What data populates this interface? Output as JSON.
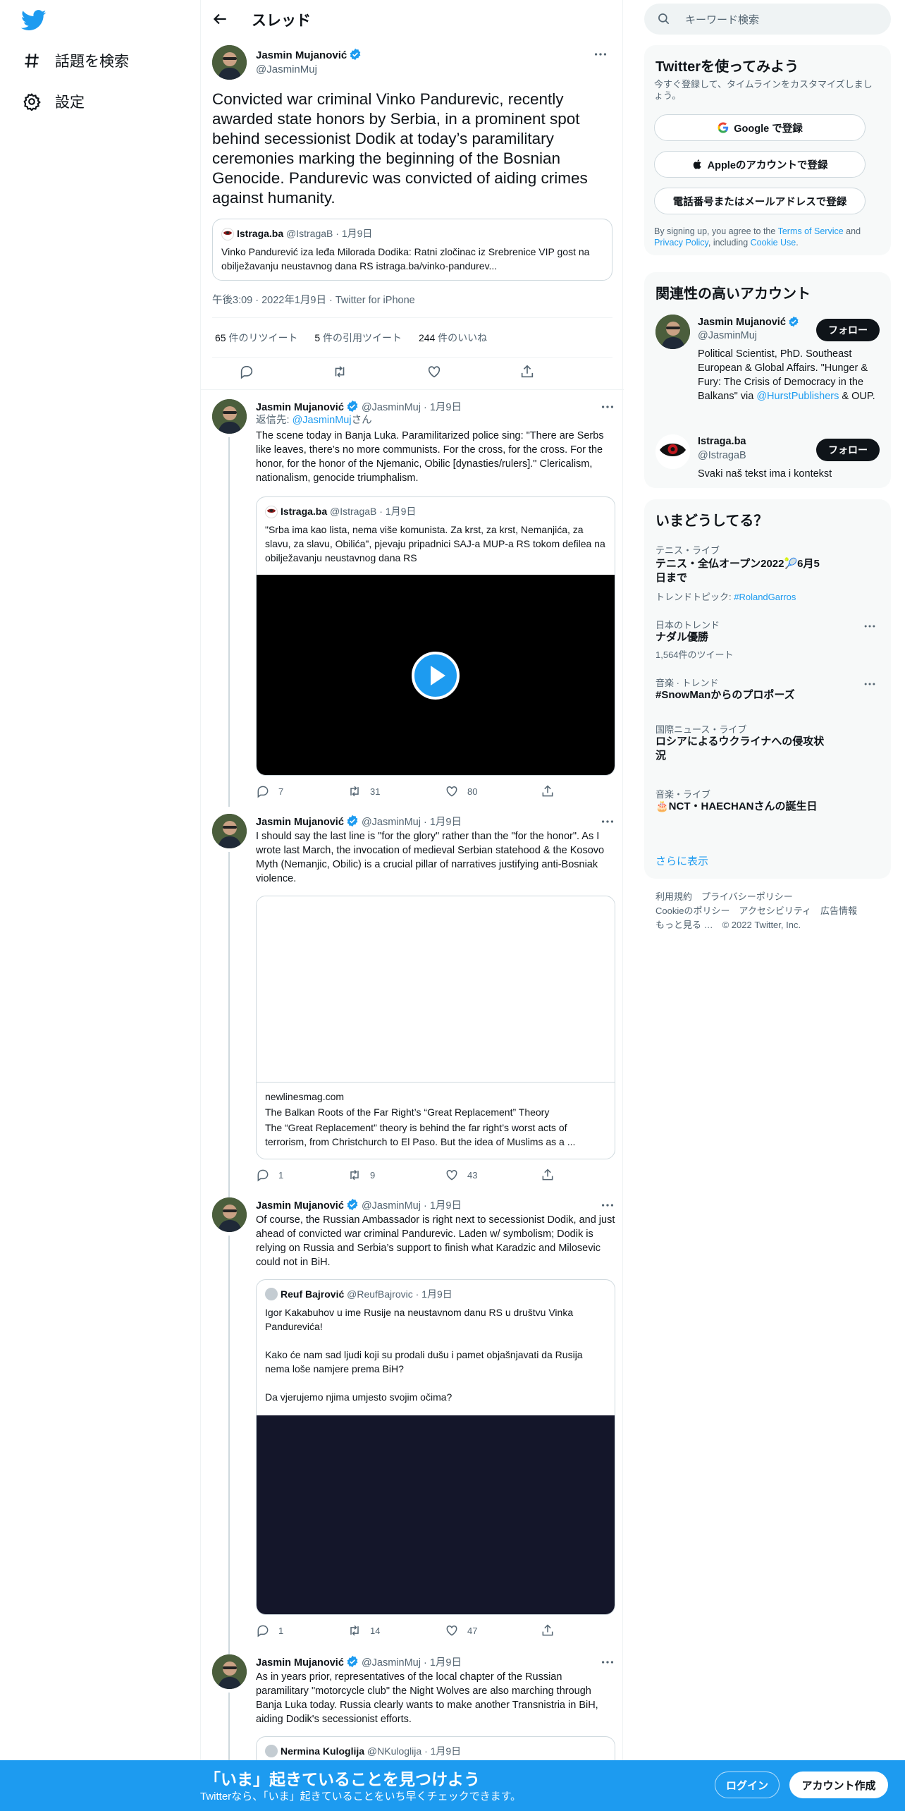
{
  "nav": {
    "explore": "話題を検索",
    "settings": "設定"
  },
  "header": {
    "title": "スレッド"
  },
  "main_tweet": {
    "name": "Jasmin Mujanović",
    "handle": "@JasminMuj",
    "text": "Convicted war criminal Vinko Pandurevic, recently awarded state honors by Serbia, in a prominent spot behind secessionist Dodik at today’s paramilitary ceremonies marking the beginning of the Bosnian Genocide. Pandurevic was convicted of aiding crimes against humanity.",
    "quote": {
      "name": "Istraga.ba",
      "handle": "@IstragaB",
      "date": "· 1月9日",
      "text": "Vinko Pandurević iza leđa Milorada Dodika: Ratni zločinac iz Srebrenice VIP gost na obilježavanju neustavnog dana RS istraga.ba/vinko-pandurev..."
    },
    "meta": "午後3:09 · 2022年1月9日 · Twitter for iPhone",
    "retweets": "65",
    "retweets_label": " 件のリツイート",
    "quotes": "5",
    "quotes_label": " 件の引用ツイート",
    "likes": "244",
    "likes_label": " 件のいいね"
  },
  "replies": [
    {
      "name": "Jasmin Mujanović",
      "handle": "@JasminMuj",
      "date": "· 1月9日",
      "replying_prefix": "返信先: ",
      "replying_handle": "@JasminMuj",
      "replying_suffix": "さん",
      "text": "The scene today in Banja Luka. Paramilitarized police sing: \"There are Serbs like leaves, there’s no more communists. For the cross, for the cross. For the honor, for the honor of the Njemanic, Obilic [dynasties/rulers].\" Clericalism, nationalism, genocide triumphalism.",
      "quote": {
        "name": "Istraga.ba",
        "handle": "@IstragaB",
        "date": "· 1月9日",
        "text": "\"Srba ima kao lista, nema više komunista. Za krst, za krst, Nemanjića, za slavu, za slavu, Obilića\", pjevaju pripadnici SAJ-a MUP-a RS tokom defilea na obilježavanju neustavnog dana RS"
      },
      "replies": "7",
      "retweets": "31",
      "likes": "80"
    },
    {
      "name": "Jasmin Mujanović",
      "handle": "@JasminMuj",
      "date": "· 1月9日",
      "text": "I should say the last line is \"for the glory\" rather than the \"for the honor\". As I wrote last March, the invocation of medieval Serbian statehood & the Kosovo Myth (Nemanjic, Obilic) is a crucial pillar of narratives justifying anti-Bosniak violence.",
      "card": {
        "domain": "newlinesmag.com",
        "title": "The Balkan Roots of the Far Right’s “Great Replacement” Theory",
        "desc": "The “Great Replacement” theory is behind the far right’s worst acts of terrorism, from Christchurch to El Paso. But the idea of Muslims as a ..."
      },
      "replies": "1",
      "retweets": "9",
      "likes": "43"
    },
    {
      "name": "Jasmin Mujanović",
      "handle": "@JasminMuj",
      "date": "· 1月9日",
      "text": "Of course, the Russian Ambassador is right next to secessionist Dodik, and just ahead of convicted war criminal Pandurevic. Laden w/ symbolism; Dodik is relying on Russia and Serbia’s support to finish what Karadzic and Milosevic could not in BiH.",
      "quote": {
        "name": "Reuf Bajrović",
        "handle": "@ReufBajrovic",
        "date": "· 1月9日",
        "text1": "Igor Kakabuhov u ime Rusije na neustavnom danu RS u društvu Vinka Pandurevića!",
        "text2": "Kako će nam sad ljudi koji su prodali dušu i pamet objašnjavati da Rusija nema loše namjere prema BiH?",
        "text3": "Da vjerujemo njima umjesto svojim očima?"
      },
      "replies": "1",
      "retweets": "14",
      "likes": "47"
    },
    {
      "name": "Jasmin Mujanović",
      "handle": "@JasminMuj",
      "date": "· 1月9日",
      "text": "As in years prior, representatives of the local chapter of the Russian paramilitary \"motorcycle club\" the Night Wolves are also marching through Banja Luka today. Russia clearly wants to make another Transnistria in BiH, aiding Dodik's secessionist efforts.",
      "quote": {
        "name": "Nermina Kuloglija",
        "handle": "@NKuloglija",
        "date": "· 1月9日"
      }
    }
  ],
  "right": {
    "search_placeholder": "キーワード検索",
    "signup": {
      "title": "Twitterを使ってみよう",
      "desc": "今すぐ登録して、タイムラインをカスタマイズしましょう。",
      "google": "Google で登録",
      "apple": "Appleのアカウントで登録",
      "phone": "電話番号またはメールアドレスで登録",
      "legal_1": "By signing up, you agree to the ",
      "legal_tos": "Terms of Service",
      "legal_2": " and ",
      "legal_privacy": "Privacy Policy",
      "legal_3": ", including ",
      "legal_cookie": "Cookie Use",
      "legal_4": "."
    },
    "relevant": {
      "title": "関連性の高いアカウント",
      "accounts": [
        {
          "name": "Jasmin Mujanović",
          "handle": "@JasminMuj",
          "bio_1": "Political Scientist, PhD. Southeast European & Global Affairs. \"Hunger & Fury: The Crisis of Democracy in the Balkans\" via ",
          "bio_link": "@HurstPublishers",
          "bio_2": " & OUP.",
          "follow": "フォロー"
        },
        {
          "name": "Istraga.ba",
          "handle": "@IstragaB",
          "bio_1": "Svaki naš tekst ima i kontekst",
          "follow": "フォロー"
        }
      ]
    },
    "trends": {
      "title": "いまどうしてる？",
      "items": [
        {
          "category": "テニス・ライブ",
          "title": "テニス・全仏オープン2022🎾6月5日まで",
          "sub_prefix": "トレンドトピック: ",
          "sub_link": "#RolandGarros"
        },
        {
          "category": "日本のトレンド",
          "title": "ナダル優勝",
          "sub": "1,564件のツイート"
        },
        {
          "category": "音楽 · トレンド",
          "title": "#SnowManからのプロポーズ"
        },
        {
          "category": "国際ニュース・ライブ",
          "title": "ロシアによるウクライナへの侵攻状況"
        },
        {
          "category": "音楽・ライブ",
          "title": "🎂NCT・HAECHANさんの誕生日"
        }
      ],
      "show_more": "さらに表示"
    },
    "footer": {
      "line1": "利用規約　プライバシーポリシー",
      "line2": "Cookieのポリシー　アクセシビリティ　広告情報",
      "line3": "もっと見る …　© 2022 Twitter, Inc."
    }
  },
  "bottom_bar": {
    "title": "「いま」起きていることを見つけよう",
    "subtitle": "Twitterなら、「いま」起きていることをいち早くチェックできます。",
    "login": "ログイン",
    "signup": "アカウント作成"
  },
  "colors": {
    "accent": "#1d9bf0",
    "text": "#0f1419",
    "muted": "#536471",
    "border": "#cfd9de"
  }
}
